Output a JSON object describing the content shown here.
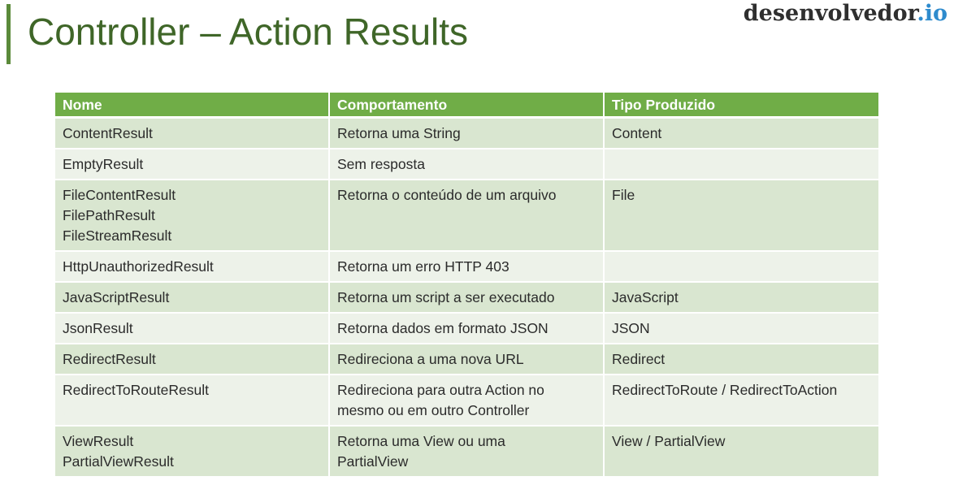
{
  "header": {
    "title": "Controller – Action Results",
    "brand_name": "desenvolvedor",
    "brand_tld": ".io"
  },
  "table": {
    "columns": [
      "Nome",
      "Comportamento",
      "Tipo Produzido"
    ],
    "rows": [
      {
        "nome": [
          "ContentResult"
        ],
        "comportamento": [
          "Retorna uma String"
        ],
        "tipo": [
          "Content"
        ]
      },
      {
        "nome": [
          "EmptyResult"
        ],
        "comportamento": [
          "Sem resposta"
        ],
        "tipo": []
      },
      {
        "nome": [
          "FileContentResult",
          "FilePathResult",
          "FileStreamResult"
        ],
        "comportamento": [
          "Retorna o conteúdo de um arquivo"
        ],
        "tipo": [
          "File"
        ]
      },
      {
        "nome": [
          "HttpUnauthorizedResult"
        ],
        "comportamento": [
          "Retorna um erro HTTP 403"
        ],
        "tipo": []
      },
      {
        "nome": [
          "JavaScriptResult"
        ],
        "comportamento": [
          "Retorna um script a ser executado"
        ],
        "tipo": [
          "JavaScript"
        ]
      },
      {
        "nome": [
          "JsonResult"
        ],
        "comportamento": [
          "Retorna dados em formato JSON"
        ],
        "tipo": [
          "JSON"
        ]
      },
      {
        "nome": [
          "RedirectResult"
        ],
        "comportamento": [
          "Redireciona a uma nova URL"
        ],
        "tipo": [
          "Redirect"
        ]
      },
      {
        "nome": [
          "RedirectToRouteResult"
        ],
        "comportamento": [
          "Redireciona para outra Action no",
          "mesmo ou em outro Controller"
        ],
        "tipo": [
          "RedirectToRoute / RedirectToAction"
        ]
      },
      {
        "nome": [
          "ViewResult",
          "PartialViewResult"
        ],
        "comportamento": [
          "Retorna uma View ou uma",
          "PartialView"
        ],
        "tipo": [
          "View / PartialView"
        ]
      }
    ]
  },
  "colors": {
    "title_green": "#3f6628",
    "accent_bar": "#5b8a3a",
    "header_green": "#70ad47",
    "row_dark": "#d9e6d0",
    "row_light": "#edf2e9",
    "brand_blue": "#2e8bcd"
  }
}
